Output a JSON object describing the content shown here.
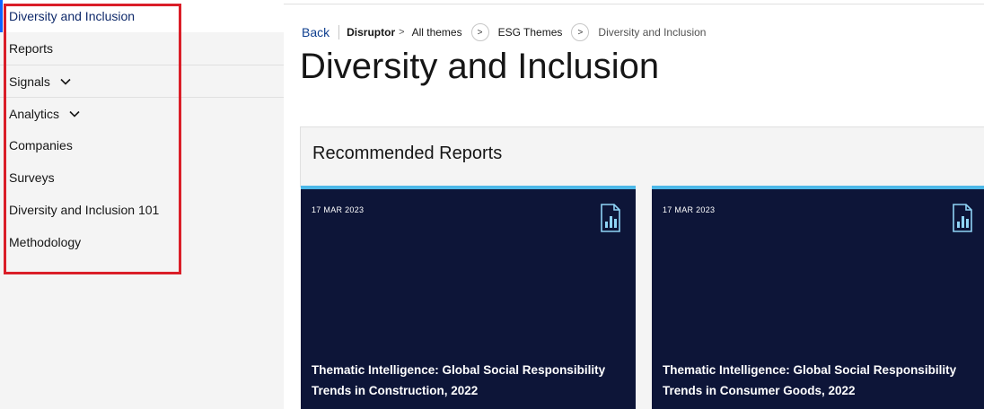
{
  "sidebar": {
    "items": [
      {
        "label": "Diversity and Inclusion",
        "active": true
      },
      {
        "label": "Reports"
      },
      {
        "label": "Signals",
        "expandable": true
      },
      {
        "label": "Analytics",
        "expandable": true
      },
      {
        "label": "Companies"
      },
      {
        "label": "Surveys"
      },
      {
        "label": "Diversity and Inclusion 101"
      },
      {
        "label": "Methodology"
      }
    ]
  },
  "breadcrumb": {
    "back": "Back",
    "items": [
      "Disruptor",
      "All themes",
      "ESG Themes",
      "Diversity and Inclusion"
    ]
  },
  "page": {
    "title": "Diversity and Inclusion"
  },
  "recommended": {
    "title": "Recommended Reports",
    "cards": [
      {
        "date": "17 MAR 2023",
        "title": "Thematic Intelligence: Global Social Responsibility Trends in Construction, 2022",
        "icon": "report-chart-icon"
      },
      {
        "date": "17 MAR 2023",
        "title": "Thematic Intelligence: Global Social Responsibility Trends in Consumer Goods, 2022",
        "icon": "report-chart-icon"
      }
    ]
  },
  "colors": {
    "accent": "#0f62fe",
    "card_bg": "#0d1538",
    "card_top_border": "#4db8e8",
    "highlight": "#da1e28"
  }
}
